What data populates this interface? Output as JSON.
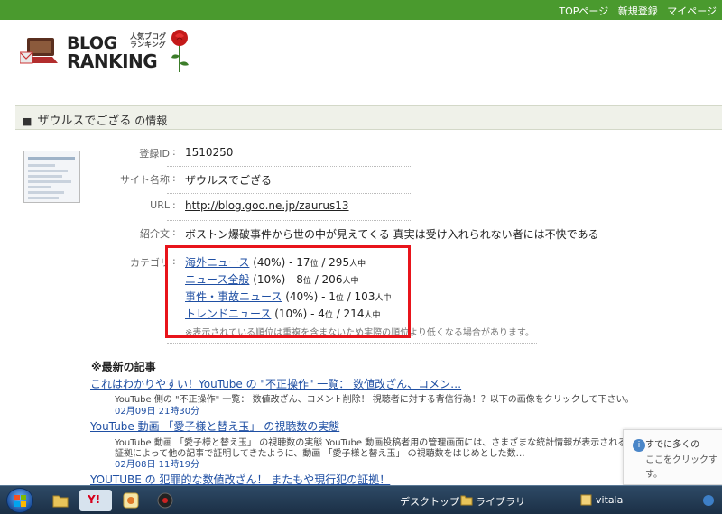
{
  "topnav": {
    "items": [
      "TOPページ",
      "新規登録",
      "マイページ"
    ]
  },
  "logo": {
    "line1": "BLOG",
    "tag": "人気ブログ ランキング",
    "line2": "RANKING"
  },
  "section": {
    "title_name": "ザウルスでござる",
    "title_suffix": " の情報",
    "marker": "■"
  },
  "info": {
    "id_label": "登録ID",
    "id_value": "1510250",
    "site_label": "サイト名称",
    "site_value": "ザウルスでござる",
    "url_label": "URL",
    "url_value": "http://blog.goo.ne.jp/zaurus13",
    "intro_label": "紹介文",
    "intro_value": "ボストン爆破事件から世の中が見えてくる 真実は受け入れられない者には不快である",
    "sep": ":",
    "category_label": "カテゴリ"
  },
  "categories": [
    {
      "name": "海外ニュース",
      "pct": " (40%) - 17",
      "rank_unit": "位",
      "total": " / 295",
      "total_unit": "人中"
    },
    {
      "name": "ニュース全般",
      "pct": " (10%) - 8",
      "rank_unit": "位",
      "total": " / 206",
      "total_unit": "人中"
    },
    {
      "name": "事件・事故ニュース",
      "pct": " (40%) - 1",
      "rank_unit": "位",
      "total": " / 103",
      "total_unit": "人中"
    },
    {
      "name": "トレンドニュース",
      "pct": " (10%) - 4",
      "rank_unit": "位",
      "total": " / 214",
      "total_unit": "人中"
    }
  ],
  "category_note": "※表示されている順位は重複を含まないため実際の順位より低くなる場合があります。",
  "latest": {
    "title": "※最新の記事",
    "articles": [
      {
        "title": "これはわかりやすい！YouTube の \"不正操作\" 一覧： 数値改ざん、コメン…",
        "desc": "YouTube 側の \"不正操作\" 一覧： 数値改ざん、コメント削除！ 視聴者に対する背信行為！？以下の画像をクリックして下さい。",
        "date": "02月09日 21時30分"
      },
      {
        "title": "YouTube 動画 「愛子様と替え玉」 の視聴数の実態",
        "desc": "YouTube 動画 「愛子様と替え玉」 の視聴数の実態 YouTube 動画投稿者用の管理画面には、さまざまな統計情報が表示される。",
        "desc2": "証拠によって他の記事で証明してきたように、動画 「愛子様と替え玉」 の視聴数をはじめとした数…",
        "date": "02月08日 11時19分"
      },
      {
        "title": "YOUTUBE の 犯罪的な数値改ざん！ またもや現行犯の証拠！",
        "desc": "",
        "date": ""
      }
    ]
  },
  "notification": {
    "line1": "すでに多くの",
    "line2": "ここをクリックす",
    "line3": "す。"
  },
  "taskbar": {
    "desktop": "デスクトップ",
    "library": "ライブラリ",
    "vitala": "vitala"
  },
  "colors": {
    "topbar": "#4a9a2e",
    "link": "#1f4fa3",
    "highlight": "#e8141b",
    "section_bg": "#eff1e9"
  }
}
